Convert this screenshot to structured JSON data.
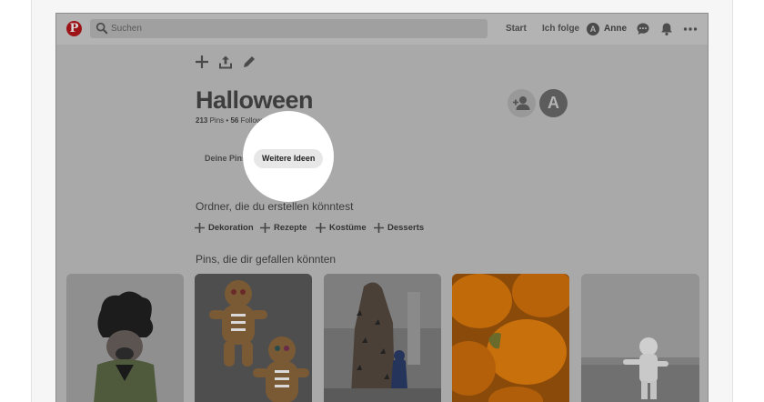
{
  "topbar": {
    "search_placeholder": "Suchen",
    "nav_start": "Start",
    "nav_following": "Ich folge",
    "user_initial": "A",
    "user_name": "Anne"
  },
  "board": {
    "title": "Halloween",
    "stats_pins": "213",
    "stats_pins_label": "Pins",
    "stats_sep": "•",
    "stats_followers": "56",
    "stats_followers_label": "Followers",
    "owner_initial": "A"
  },
  "tabs": {
    "own_pins": "Deine Pins",
    "more_ideas": "Weitere Ideen"
  },
  "sections": {
    "boards_title": "Ordner, die du erstellen könntest",
    "pins_title": "Pins, die dir gefallen könnten"
  },
  "board_suggestions": [
    "Dekoration",
    "Rezepte",
    "Kostüme",
    "Desserts"
  ],
  "pins": [
    {
      "icon": "dog-costume-image"
    },
    {
      "icon": "skeleton-cookies-image"
    },
    {
      "icon": "kids-costume-image"
    },
    {
      "icon": "pumpkins-image"
    },
    {
      "icon": "mummy-baby-image"
    }
  ],
  "colors": {
    "overlay_gray": "#a9a9a9",
    "logo_red": "#9c1418",
    "pumpkin_orange": "#c06a0a"
  }
}
